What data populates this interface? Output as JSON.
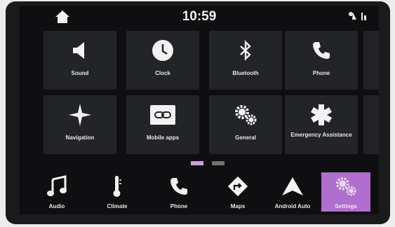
{
  "status_bar": {
    "time": "10:59",
    "home_icon": "home-icon",
    "signal_icon": "phone-signal-icon",
    "connectivity_icon": "connectivity-icon"
  },
  "tiles": [
    {
      "label": "Sound",
      "icon": "speaker-icon"
    },
    {
      "label": "Clock",
      "icon": "clock-icon"
    },
    {
      "label": "Bluetooth",
      "icon": "bluetooth-icon"
    },
    {
      "label": "Phone",
      "icon": "phone-icon"
    },
    {
      "label": "Navigation",
      "icon": "compass-star-icon"
    },
    {
      "label": "Mobile apps",
      "icon": "link-icon"
    },
    {
      "label": "General",
      "icon": "gears-icon"
    },
    {
      "label": "Emergency Assistance",
      "icon": "star-of-life-icon"
    }
  ],
  "pager": {
    "pages": 2,
    "current_page": 1,
    "active_color": "#d59be0",
    "inactive_color": "#6f7070"
  },
  "dock": [
    {
      "label": "Audio",
      "icon": "music-note-icon"
    },
    {
      "label": "Climate",
      "icon": "thermometer-icon"
    },
    {
      "label": "Phone",
      "icon": "phone-icon"
    },
    {
      "label": "Maps",
      "icon": "directions-icon"
    },
    {
      "label": "Android Auto",
      "icon": "android-auto-icon"
    },
    {
      "label": "Settings",
      "icon": "gears-icon",
      "active": true
    }
  ],
  "colors": {
    "screen_bg": "#0f0f11",
    "tile_bg": "#232427",
    "active_accent": "#b06fcf",
    "text": "#e8e8e8"
  }
}
